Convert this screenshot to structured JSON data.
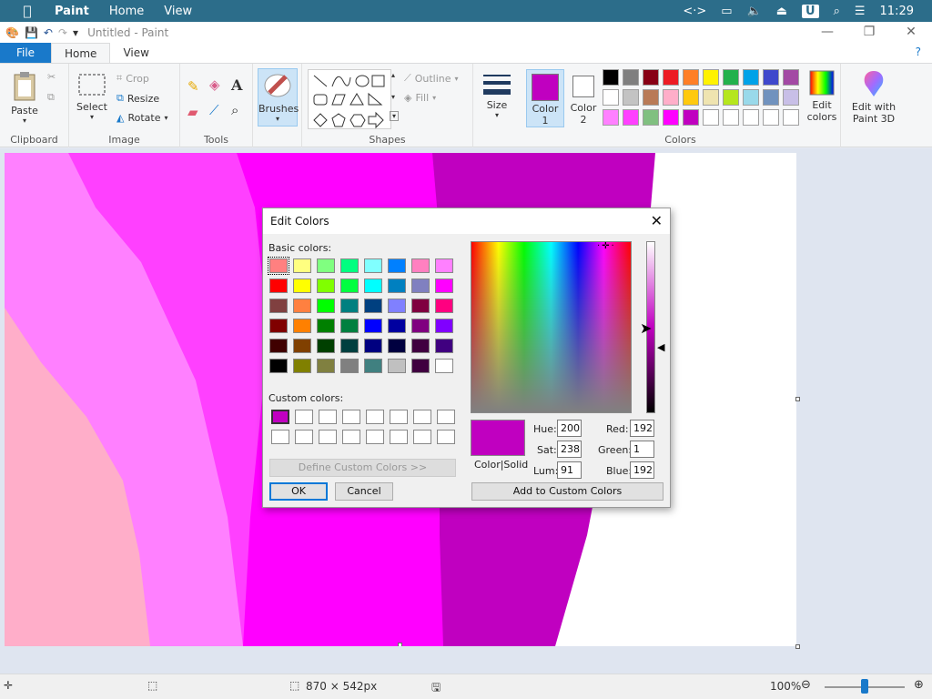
{
  "menubar": {
    "app": "Paint",
    "items": [
      "Home",
      "View"
    ],
    "time": "11:29"
  },
  "window": {
    "title": "Untitled - Paint"
  },
  "tabs": {
    "file": "File",
    "home": "Home",
    "view": "View"
  },
  "ribbon": {
    "clipboard": {
      "paste": "Paste",
      "group": "Clipboard"
    },
    "image": {
      "select": "Select",
      "crop": "Crop",
      "resize": "Resize",
      "rotate": "Rotate",
      "group": "Image"
    },
    "tools": {
      "group": "Tools"
    },
    "brushes": "Brushes",
    "shapes": {
      "outline": "Outline",
      "fill": "Fill",
      "group": "Shapes"
    },
    "size": "Size",
    "color1": "Color\n1",
    "color1_line1": "Color",
    "color1_line2": "1",
    "color2_line1": "Color",
    "color2_line2": "2",
    "colors_group": "Colors",
    "edit_colors_line1": "Edit",
    "edit_colors_line2": "colors",
    "paint3d_line1": "Edit with",
    "paint3d_line2": "Paint 3D",
    "color1_value": "#c000c0",
    "color2_value": "#ffffff",
    "palette_row1": [
      "#000000",
      "#7f7f7f",
      "#880015",
      "#ed1c24",
      "#ff7f27",
      "#fff200",
      "#22b14c",
      "#00a2e8",
      "#3f48cc",
      "#a349a4"
    ],
    "palette_row2": [
      "#ffffff",
      "#c3c3c3",
      "#b97a57",
      "#ffaec9",
      "#ffc90e",
      "#efe4b0",
      "#b5e61d",
      "#99d9ea",
      "#7092be",
      "#c8bfe7"
    ],
    "palette_row3": [
      "#ff80ff",
      "#ff40ff",
      "#80c080",
      "#ff00ff",
      "#c000c0",
      "#ffffff",
      "#ffffff",
      "#ffffff",
      "#ffffff",
      "#ffffff"
    ]
  },
  "dialog": {
    "title": "Edit Colors",
    "basic_colors_label": "Basic colors:",
    "custom_colors_label": "Custom colors:",
    "define_custom": "Define Custom Colors >>",
    "ok": "OK",
    "cancel": "Cancel",
    "add_custom": "Add to Custom Colors",
    "color_solid": "Color|Solid",
    "hue_label": "Hue:",
    "hue": "200",
    "sat_label": "Sat:",
    "sat": "238",
    "lum_label": "Lum:",
    "lum": "91",
    "red_label": "Red:",
    "red": "192",
    "green_label": "Green:",
    "green": "1",
    "blue_label": "Blue:",
    "blue": "192",
    "preview_color": "#c000c0",
    "basic_colors": [
      [
        "#ff8080",
        "#ffff80",
        "#80ff80",
        "#00ff80",
        "#80ffff",
        "#0080ff",
        "#ff80c0",
        "#ff80ff"
      ],
      [
        "#ff0000",
        "#ffff00",
        "#80ff00",
        "#00ff40",
        "#00ffff",
        "#0080c0",
        "#8080c0",
        "#ff00ff"
      ],
      [
        "#804040",
        "#ff8040",
        "#00ff00",
        "#008080",
        "#004080",
        "#8080ff",
        "#800040",
        "#ff0080"
      ],
      [
        "#800000",
        "#ff8000",
        "#008000",
        "#008040",
        "#0000ff",
        "#0000a0",
        "#800080",
        "#8000ff"
      ],
      [
        "#400000",
        "#804000",
        "#004000",
        "#004040",
        "#000080",
        "#000040",
        "#400040",
        "#400080"
      ],
      [
        "#000000",
        "#808000",
        "#808040",
        "#808080",
        "#408080",
        "#c0c0c0",
        "#400040",
        "#ffffff"
      ]
    ],
    "custom_colors": [
      [
        "#c000c0",
        "#ffffff",
        "#ffffff",
        "#ffffff",
        "#ffffff",
        "#ffffff",
        "#ffffff",
        "#ffffff"
      ],
      [
        "#ffffff",
        "#ffffff",
        "#ffffff",
        "#ffffff",
        "#ffffff",
        "#ffffff",
        "#ffffff",
        "#ffffff"
      ]
    ]
  },
  "status": {
    "dimensions": "870 × 542px",
    "zoom": "100%"
  }
}
